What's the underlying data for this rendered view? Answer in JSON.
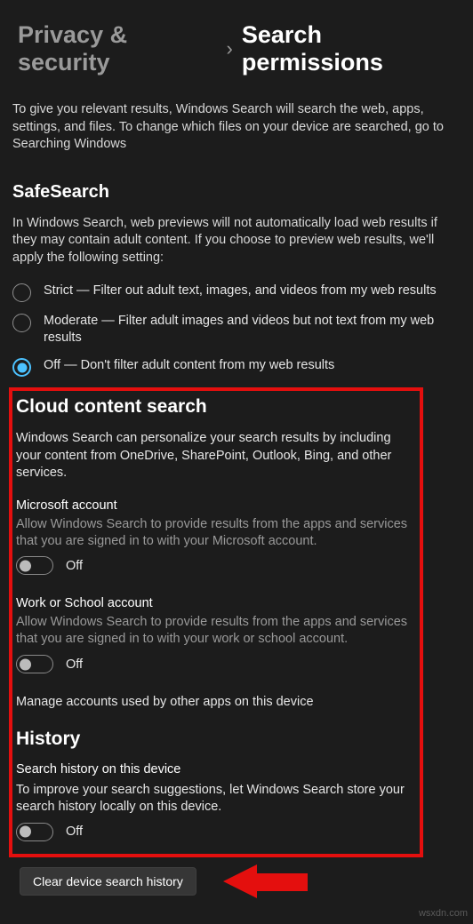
{
  "breadcrumb": {
    "parent": "Privacy & security",
    "current": "Search permissions"
  },
  "intro": {
    "text_a": "To give you relevant results, Windows Search will search the web, apps, settings, and files. To change which files on your device are searched, go to ",
    "link": "Searching Windows"
  },
  "safesearch": {
    "heading": "SafeSearch",
    "desc": "In Windows Search, web previews will not automatically load web results if they may contain adult content. If you choose to preview web results, we'll apply the following setting:",
    "options": {
      "strict": "Strict — Filter out adult text, images, and videos from my web results",
      "moderate": "Moderate — Filter adult images and videos but not text from my web results",
      "off": "Off — Don't filter adult content from my web results"
    },
    "selected": "off"
  },
  "cloud": {
    "heading": "Cloud content search",
    "desc": "Windows Search can personalize your search results by including your content from OneDrive, SharePoint, Outlook, Bing, and other services.",
    "ms": {
      "title": "Microsoft account",
      "desc": "Allow Windows Search to provide results from the apps and services that you are signed in to with your Microsoft account.",
      "state": "Off"
    },
    "work": {
      "title": "Work or School account",
      "desc": "Allow Windows Search to provide results from the apps and services that you are signed in to with your work or school account.",
      "state": "Off"
    },
    "manage": "Manage accounts used by other apps on this device"
  },
  "history": {
    "heading": "History",
    "title": "Search history on this device",
    "desc": "To improve your search suggestions, let Windows Search store your search history locally on this device.",
    "state": "Off",
    "clear_btn": "Clear device search history"
  },
  "watermark": "wsxdn.com"
}
